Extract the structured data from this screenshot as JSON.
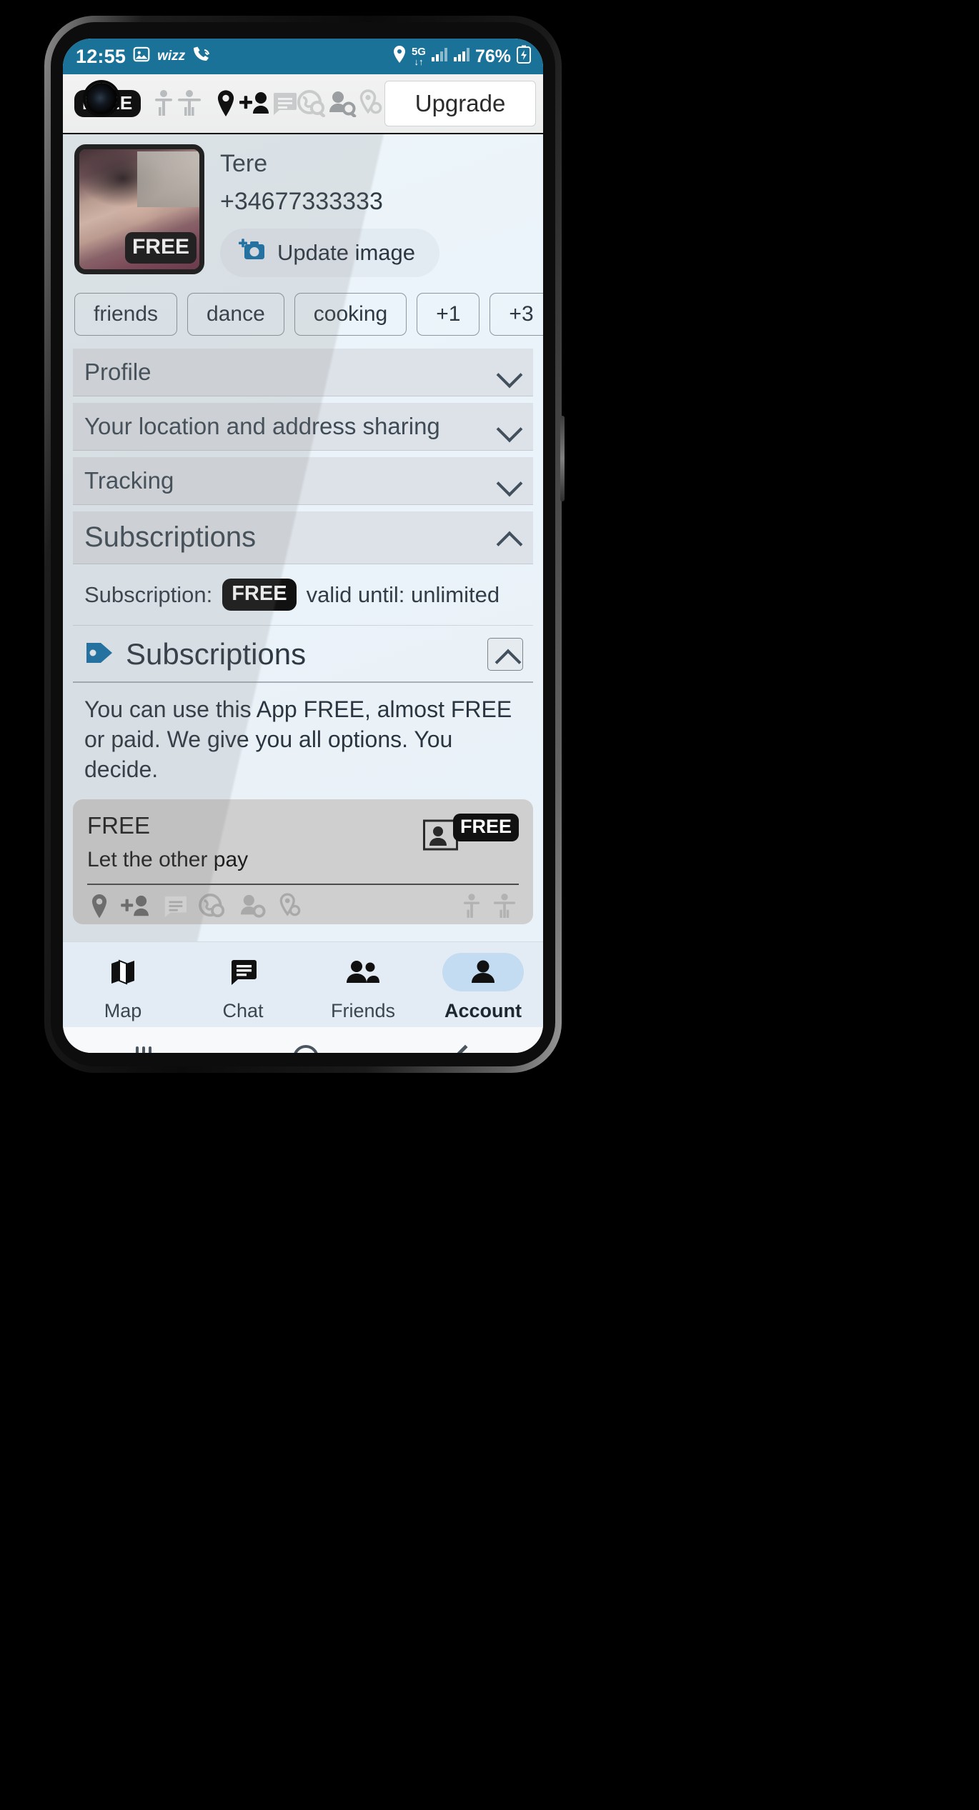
{
  "status_bar": {
    "time": "12:55",
    "left_icons": [
      "photo-icon",
      "wizz-icon",
      "phone-wifi-call-icon"
    ],
    "right_icons": [
      "location-icon",
      "5g-icon",
      "signal-icon-1",
      "signal-icon-2"
    ],
    "battery_text": "76%",
    "battery_icon": "battery-charging-icon",
    "background_color": "#1a7298"
  },
  "toolbar": {
    "free_badge": "FREE",
    "icons": [
      "person-inactive-icon",
      "person-active-icon",
      "location-pin-icon",
      "add-person-icon",
      "chat-bubble-icon",
      "globe-search-icon",
      "person-search-icon",
      "pin-search-icon"
    ],
    "upgrade_label": "Upgrade"
  },
  "profile": {
    "name": "Tere",
    "phone": "+34677333333",
    "avatar_badge": "FREE",
    "update_image_label": "Update image",
    "update_image_icon": "add-photo-camera-icon"
  },
  "tags": [
    "friends",
    "dance",
    "cooking",
    "+1",
    "+3"
  ],
  "sections": [
    {
      "label": "Profile",
      "expanded": false,
      "chevron": "chevron-down-icon"
    },
    {
      "label": "Your location and address sharing",
      "expanded": false,
      "chevron": "chevron-down-icon"
    },
    {
      "label": "Tracking",
      "expanded": false,
      "chevron": "chevron-down-icon"
    },
    {
      "label": "Subscriptions",
      "expanded": true,
      "chevron": "chevron-up-icon"
    }
  ],
  "subscription_status": {
    "prefix": "Subscription:",
    "plan_badge": "FREE",
    "suffix": "valid until: unlimited"
  },
  "subscriptions_panel": {
    "icon": "tag-icon",
    "title": "Subscriptions",
    "collapse_icon": "chevron-up-icon",
    "description": "You can use this App FREE, almost FREE or paid. We give you all options. You decide.",
    "plan": {
      "title": "FREE",
      "subtitle": "Let the other pay",
      "badge": "FREE",
      "badge_icon": "person-card-icon",
      "feature_icons": [
        "location-pin-icon",
        "add-person-icon",
        "chat-bubble-icon",
        "globe-search-icon",
        "person-search-icon",
        "pin-search-icon",
        "person-inactive-icon",
        "person-active-icon"
      ]
    }
  },
  "bottom_nav": [
    {
      "label": "Map",
      "icon": "map-icon",
      "active": false
    },
    {
      "label": "Chat",
      "icon": "chat-icon",
      "active": false
    },
    {
      "label": "Friends",
      "icon": "friends-icon",
      "active": false
    },
    {
      "label": "Account",
      "icon": "account-icon",
      "active": true
    }
  ],
  "android_nav": [
    "recents-button",
    "home-button",
    "back-button"
  ],
  "colors": {
    "status_bar": "#1a7298",
    "accent": "#1a7298",
    "section_header": "#dde2e8",
    "nav_active_pill": "#c3dcf2",
    "badge_black": "#111111"
  }
}
